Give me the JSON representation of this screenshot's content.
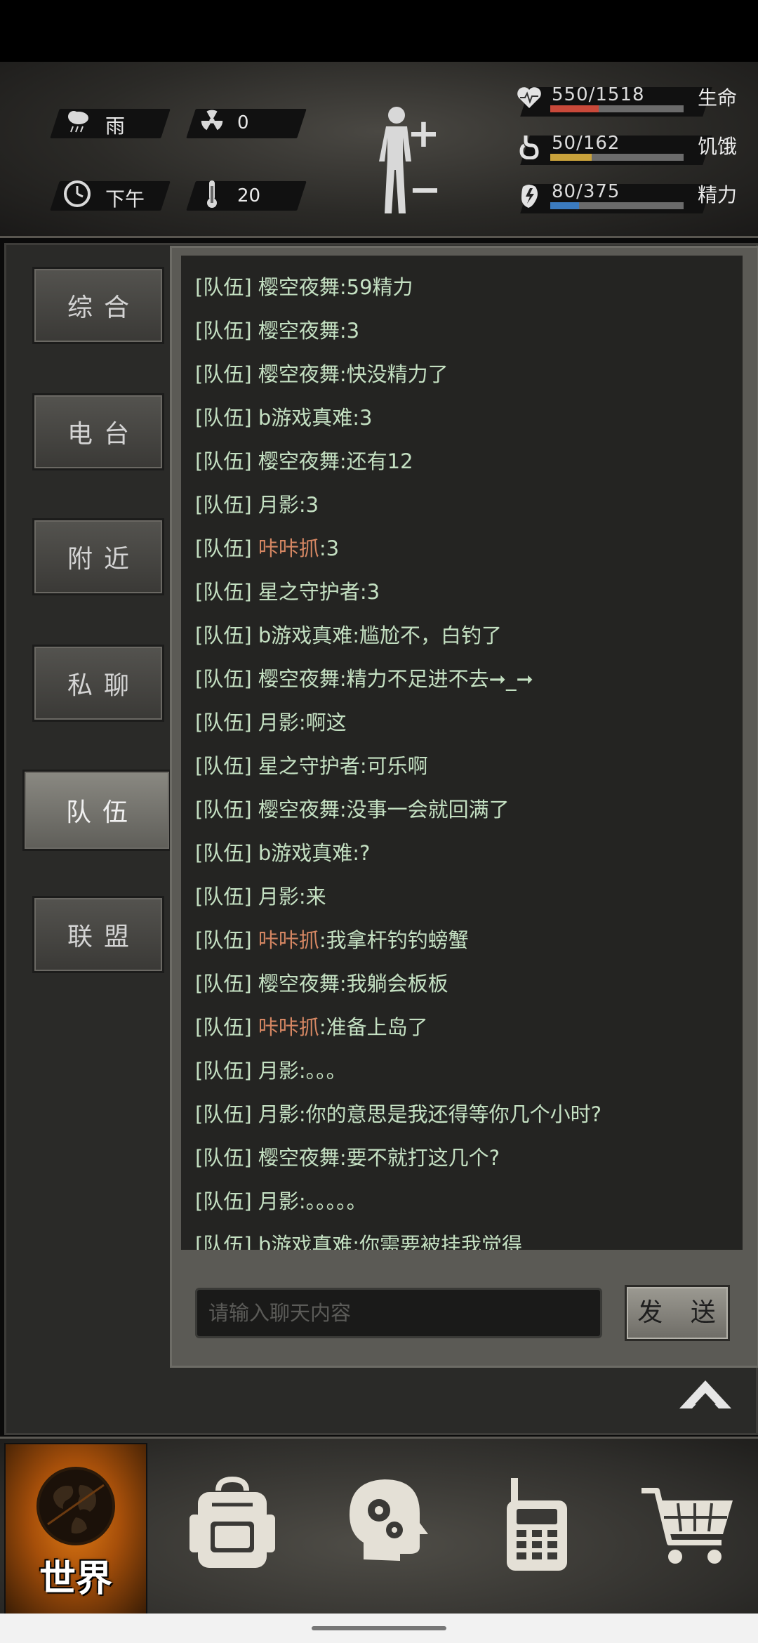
{
  "hud": {
    "weather": {
      "icon": "rain-cloud-icon",
      "label": "雨"
    },
    "radiation": {
      "icon": "radiation-icon",
      "value": "0"
    },
    "time": {
      "icon": "clock-icon",
      "label": "下午"
    },
    "temperature": {
      "icon": "thermometer-icon",
      "value": "20"
    },
    "stats": [
      {
        "name": "生命",
        "icon": "heart-icon",
        "value": "550/1518",
        "current": 550,
        "max": 1518,
        "color": "#c9493a"
      },
      {
        "name": "饥饿",
        "icon": "stomach-icon",
        "value": "50/162",
        "current": 50,
        "max": 162,
        "color": "#c9a23b"
      },
      {
        "name": "精力",
        "icon": "energy-icon",
        "value": "80/375",
        "current": 80,
        "max": 375,
        "color": "#3b7bc0"
      }
    ]
  },
  "tabs": [
    {
      "label": "综合",
      "active": false
    },
    {
      "label": "电台",
      "active": false
    },
    {
      "label": "附近",
      "active": false
    },
    {
      "label": "私聊",
      "active": false
    },
    {
      "label": "队伍",
      "active": true
    },
    {
      "label": "联盟",
      "active": false
    }
  ],
  "chat": {
    "messages": [
      {
        "tag": "[队伍]",
        "sender": "樱空夜舞",
        "text": ":59精力",
        "highlight": false
      },
      {
        "tag": "[队伍]",
        "sender": "樱空夜舞",
        "text": ":3",
        "highlight": false
      },
      {
        "tag": "[队伍]",
        "sender": "樱空夜舞",
        "text": ":快没精力了",
        "highlight": false
      },
      {
        "tag": "[队伍]",
        "sender": "b游戏真难",
        "text": ":3",
        "highlight": false
      },
      {
        "tag": "[队伍]",
        "sender": "樱空夜舞",
        "text": ":还有12",
        "highlight": false
      },
      {
        "tag": "[队伍]",
        "sender": "月影",
        "text": ":3",
        "highlight": false
      },
      {
        "tag": "[队伍]",
        "sender": "咔咔抓",
        "text": ":3",
        "highlight": true
      },
      {
        "tag": "[队伍]",
        "sender": "星之守护者",
        "text": ":3",
        "highlight": false
      },
      {
        "tag": "[队伍]",
        "sender": "b游戏真难",
        "text": ":尴尬不，白钓了",
        "highlight": false
      },
      {
        "tag": "[队伍]",
        "sender": "樱空夜舞",
        "text": ":精力不足进不去➞_➞",
        "highlight": false
      },
      {
        "tag": "[队伍]",
        "sender": "月影",
        "text": ":啊这",
        "highlight": false
      },
      {
        "tag": "[队伍]",
        "sender": "星之守护者",
        "text": ":可乐啊",
        "highlight": false
      },
      {
        "tag": "[队伍]",
        "sender": "樱空夜舞",
        "text": ":没事一会就回满了",
        "highlight": false
      },
      {
        "tag": "[队伍]",
        "sender": "b游戏真难",
        "text": ":?",
        "highlight": false
      },
      {
        "tag": "[队伍]",
        "sender": "月影",
        "text": ":来",
        "highlight": false
      },
      {
        "tag": "[队伍]",
        "sender": "咔咔抓",
        "text": ":我拿杆钓钓螃蟹",
        "highlight": true
      },
      {
        "tag": "[队伍]",
        "sender": "樱空夜舞",
        "text": ":我躺会板板",
        "highlight": false
      },
      {
        "tag": "[队伍]",
        "sender": "咔咔抓",
        "text": ":准备上岛了",
        "highlight": true
      },
      {
        "tag": "[队伍]",
        "sender": "月影",
        "text": ":。。。",
        "highlight": false
      },
      {
        "tag": "[队伍]",
        "sender": "月影",
        "text": ":你的意思是我还得等你几个小时?",
        "highlight": false
      },
      {
        "tag": "[队伍]",
        "sender": "樱空夜舞",
        "text": ":要不就打这几个?",
        "highlight": false
      },
      {
        "tag": "[队伍]",
        "sender": "月影",
        "text": ":。。。。。",
        "highlight": false
      },
      {
        "tag": "[队伍]",
        "sender": "b游戏真难",
        "text": ":你需要被挂我觉得",
        "highlight": false
      }
    ],
    "input_placeholder": "请输入聊天内容",
    "send_label": "发 送"
  },
  "bottom_nav": [
    {
      "name": "world",
      "label": "世界",
      "icon": "globe-icon",
      "active": true
    },
    {
      "name": "backpack",
      "label": "",
      "icon": "backpack-icon",
      "active": false
    },
    {
      "name": "skills",
      "label": "",
      "icon": "brain-gears-icon",
      "active": false
    },
    {
      "name": "radio",
      "label": "",
      "icon": "walkie-talkie-icon",
      "active": false
    },
    {
      "name": "shop",
      "label": "",
      "icon": "cart-icon",
      "active": false
    }
  ]
}
